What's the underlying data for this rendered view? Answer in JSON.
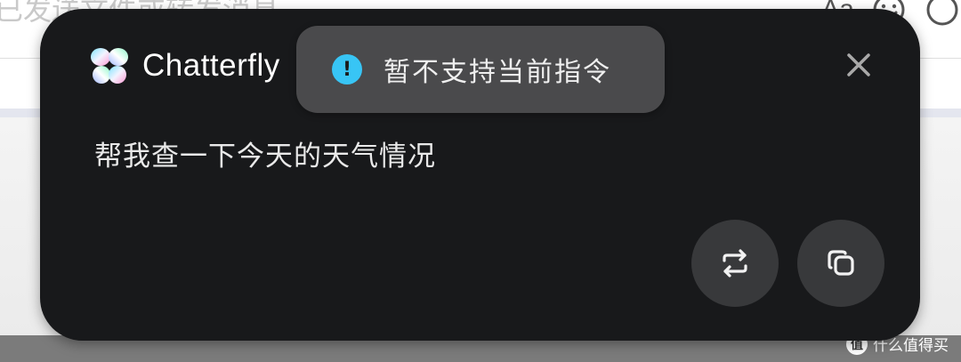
{
  "background": {
    "input_text": "已发送文件或转发消息",
    "font_icon": "Aa",
    "emoji_icon": "smile-icon",
    "more_icon": "more-icon"
  },
  "popup": {
    "brand_name": "Chatterfly",
    "brand_logo": "butterfly-logo-icon",
    "close_icon": "close-icon",
    "message": "帮我查一下今天的天气情况",
    "repeat_icon": "repeat-icon",
    "copy_icon": "copy-icon"
  },
  "toast": {
    "icon": "info-icon",
    "icon_glyph": "!",
    "text": "暂不支持当前指令"
  },
  "watermark": {
    "logo_glyph": "值",
    "text": "什么值得买"
  },
  "colors": {
    "popup_bg": "#18191b",
    "toast_bg": "#4a4a4c",
    "accent_info": "#38c5f5",
    "round_button_bg": "#38393b"
  }
}
